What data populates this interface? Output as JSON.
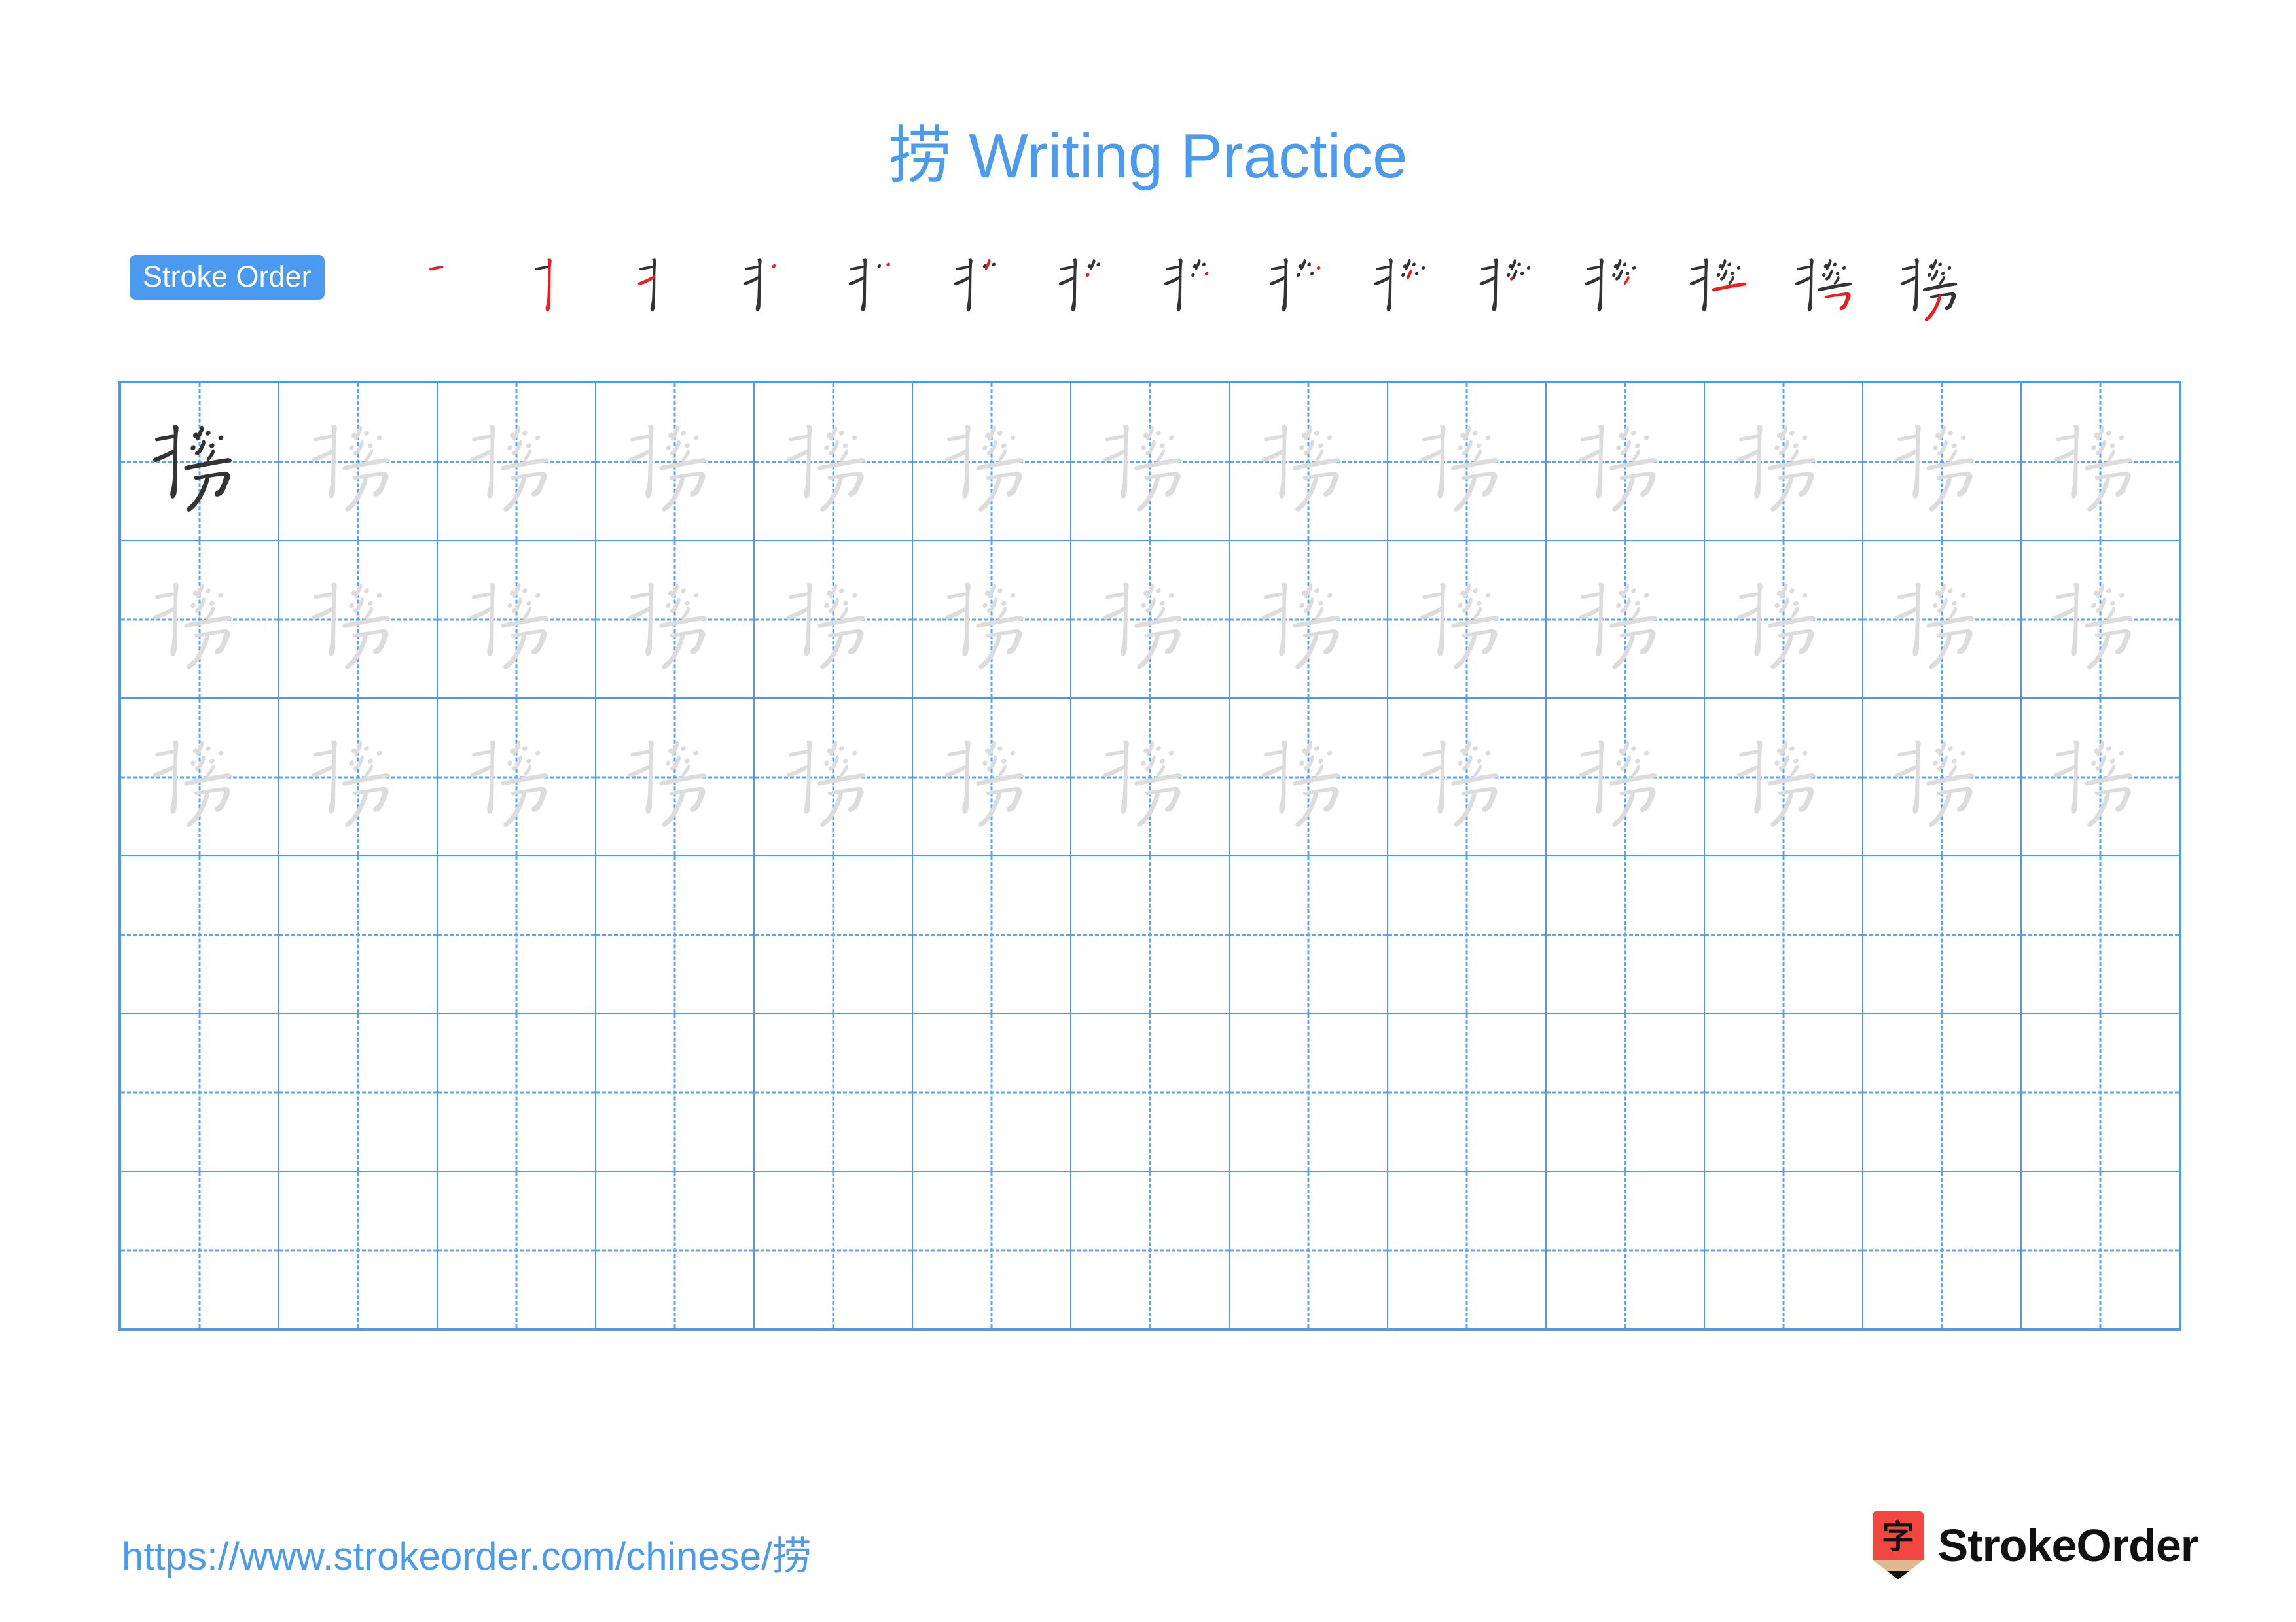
{
  "character": "捞",
  "title": {
    "character": "捞",
    "suffix": " Writing Practice",
    "full": "捞 Writing Practice",
    "color": "#4a9af0"
  },
  "stroke_order": {
    "badge_label": "Stroke Order",
    "badge_bg": "#4a9af0",
    "badge_text_color": "#ffffff",
    "new_stroke_color": "#ee1c1c",
    "existing_stroke_color": "#333333",
    "total_strokes": 15,
    "steps": [
      {
        "index": 1,
        "strokes_shown": 1,
        "new_stroke": "héng (horizontal)"
      },
      {
        "index": 2,
        "strokes_shown": 2,
        "new_stroke": "shù gōu (vertical hook)"
      },
      {
        "index": 3,
        "strokes_shown": 3,
        "new_stroke": "tí (rising)"
      },
      {
        "index": 4,
        "strokes_shown": 4,
        "new_stroke": "diǎn (dot)"
      },
      {
        "index": 5,
        "strokes_shown": 5,
        "new_stroke": "diǎn (dot)"
      },
      {
        "index": 6,
        "strokes_shown": 6,
        "new_stroke": "piě (left-falling)"
      },
      {
        "index": 7,
        "strokes_shown": 7,
        "new_stroke": "diǎn (dot)"
      },
      {
        "index": 8,
        "strokes_shown": 8,
        "new_stroke": "diǎn (dot)"
      },
      {
        "index": 9,
        "strokes_shown": 9,
        "new_stroke": "diǎn (dot)"
      },
      {
        "index": 10,
        "strokes_shown": 10,
        "new_stroke": "piě (left-falling)"
      },
      {
        "index": 11,
        "strokes_shown": 11,
        "new_stroke": "diǎn (dot)"
      },
      {
        "index": 12,
        "strokes_shown": 12,
        "new_stroke": "piě (left-falling)"
      },
      {
        "index": 13,
        "strokes_shown": 13,
        "new_stroke": "héng gōu (horizontal hook)"
      },
      {
        "index": 14,
        "strokes_shown": 14,
        "new_stroke": "héng zhé gōu (bend hook)"
      },
      {
        "index": 15,
        "strokes_shown": 15,
        "new_stroke": "piě (left-falling)"
      }
    ]
  },
  "practice_grid": {
    "columns": 13,
    "rows": 6,
    "border_color": "#4a9af0",
    "guide_color": "#5aa6f5",
    "model_color": "#333333",
    "trace_color": "#dcdcdc",
    "row_contents": [
      {
        "row": 1,
        "cells": [
          "model",
          "trace",
          "trace",
          "trace",
          "trace",
          "trace",
          "trace",
          "trace",
          "trace",
          "trace",
          "trace",
          "trace",
          "trace"
        ]
      },
      {
        "row": 2,
        "cells": [
          "trace",
          "trace",
          "trace",
          "trace",
          "trace",
          "trace",
          "trace",
          "trace",
          "trace",
          "trace",
          "trace",
          "trace",
          "trace"
        ]
      },
      {
        "row": 3,
        "cells": [
          "trace",
          "trace",
          "trace",
          "trace",
          "trace",
          "trace",
          "trace",
          "trace",
          "trace",
          "trace",
          "trace",
          "trace",
          "trace"
        ]
      },
      {
        "row": 4,
        "cells": [
          "empty",
          "empty",
          "empty",
          "empty",
          "empty",
          "empty",
          "empty",
          "empty",
          "empty",
          "empty",
          "empty",
          "empty",
          "empty"
        ]
      },
      {
        "row": 5,
        "cells": [
          "empty",
          "empty",
          "empty",
          "empty",
          "empty",
          "empty",
          "empty",
          "empty",
          "empty",
          "empty",
          "empty",
          "empty",
          "empty"
        ]
      },
      {
        "row": 6,
        "cells": [
          "empty",
          "empty",
          "empty",
          "empty",
          "empty",
          "empty",
          "empty",
          "empty",
          "empty",
          "empty",
          "empty",
          "empty",
          "empty"
        ]
      }
    ]
  },
  "footer": {
    "url": "https://www.strokeorder.com/chinese/捞",
    "url_color": "#4a9af0",
    "brand_name": "StrokeOrder",
    "brand_mark_character": "字",
    "brand_mark_color": "#f0483f",
    "brand_mark_tip_color": "#e0b894",
    "brand_text_color": "#111111"
  }
}
